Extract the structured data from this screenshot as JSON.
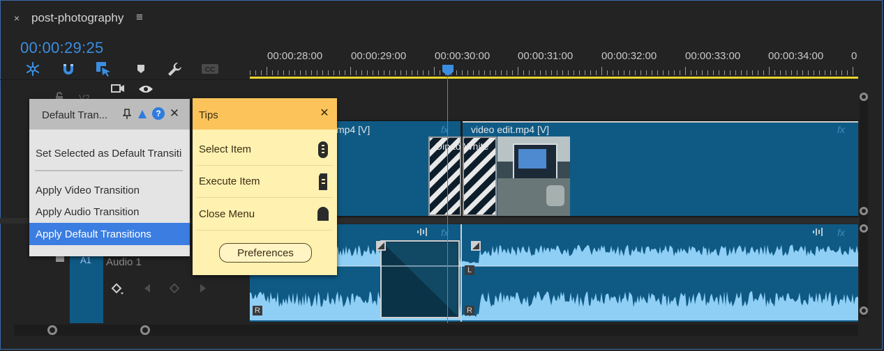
{
  "window": {
    "close_glyph": "×",
    "title": "post-photography",
    "menu_glyph": "≡"
  },
  "timecode": "00:00:29:25",
  "tools": [
    {
      "name": "snap-icon",
      "glyph": "✱"
    },
    {
      "name": "magnet-icon",
      "glyph": "∩"
    },
    {
      "name": "linked-selection-icon",
      "glyph": "⬔"
    },
    {
      "name": "marker-icon",
      "glyph": "⬟"
    },
    {
      "name": "wrench-icon",
      "glyph": "🔧"
    },
    {
      "name": "captions-icon",
      "glyph": "CC"
    }
  ],
  "ruler": {
    "labels": [
      "00:00:28:00",
      "00:00:29:00",
      "00:00:30:00",
      "00:00:31:00",
      "00:00:32:00",
      "00:00:33:00",
      "00:00:34:00",
      "0"
    ]
  },
  "track_headers": {
    "v2": "V2",
    "audio_track": "A1",
    "audio_name": "Audio 1"
  },
  "clips": {
    "video_left_label": "mp4 [V]",
    "video_right_label": "video edit.mp4 [V]",
    "transition_label": "Dip to White",
    "fx": "fx",
    "left_channel": "L",
    "right_channel": "R"
  },
  "default_transitions_panel": {
    "title": "Default Tran...",
    "items": [
      "Set Selected as Default Transiti",
      "Apply Video Transition",
      "Apply Audio Transition",
      "Apply Default Transitions"
    ],
    "selected_index": 3,
    "close_glyph": "✕",
    "help_glyph": "?"
  },
  "tips_panel": {
    "title": "Tips",
    "close_glyph": "✕",
    "items": [
      "Select Item",
      "Execute Item",
      "Close Menu"
    ],
    "preferences_label": "Preferences"
  },
  "colors": {
    "accent": "#3b8de1",
    "clip_blue": "#0f5a85",
    "waveform": "#8fcff5",
    "work_area": "#e9d62c",
    "tips_header": "#fcc35a",
    "tips_body": "#fff1b0",
    "selected": "#3b7de1"
  }
}
